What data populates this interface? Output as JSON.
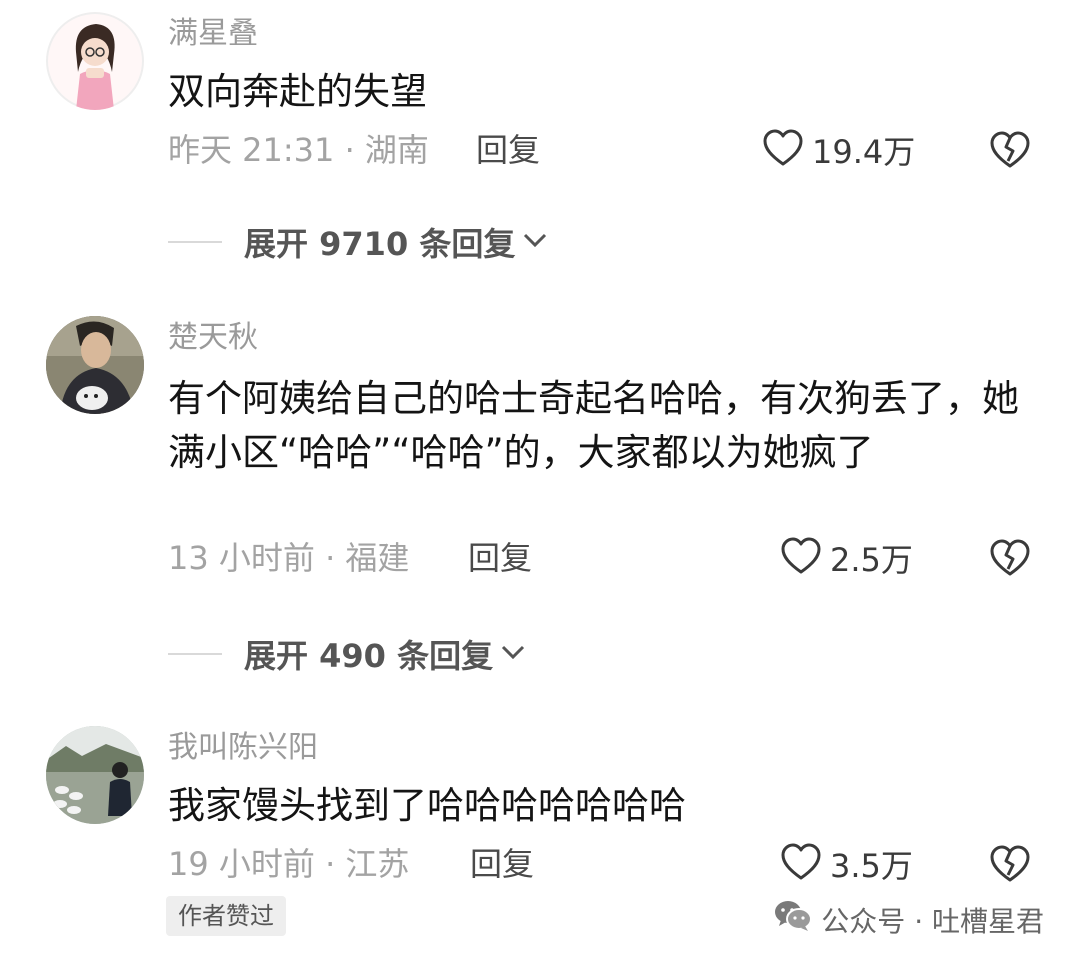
{
  "comments": [
    {
      "username": "满星叠",
      "content": "双向奔赴的失望",
      "meta": "昨天 21:31 · 湖南",
      "reply_label": "回复",
      "likes": "19.4万",
      "expand_label": "展开 9710 条回复"
    },
    {
      "username": "楚天秋",
      "content": "有个阿姨给自己的哈士奇起名哈哈，有次狗丢了，她满小区“哈哈”“哈哈”的，大家都以为她疯了",
      "meta": "13 小时前 · 福建",
      "reply_label": "回复",
      "likes": "2.5万",
      "expand_label": "展开 490 条回复"
    },
    {
      "username": "我叫陈兴阳",
      "content": "我家馒头找到了哈哈哈哈哈哈哈",
      "meta": "19 小时前 · 江苏",
      "reply_label": "回复",
      "likes": "3.5万",
      "badge": "作者赞过"
    }
  ],
  "watermark": "公众号 · 吐槽星君",
  "icons": {
    "like": "heart-outline-icon",
    "dislike": "broken-heart-icon",
    "expand": "chevron-down-icon",
    "watermark": "wechat-icon"
  }
}
